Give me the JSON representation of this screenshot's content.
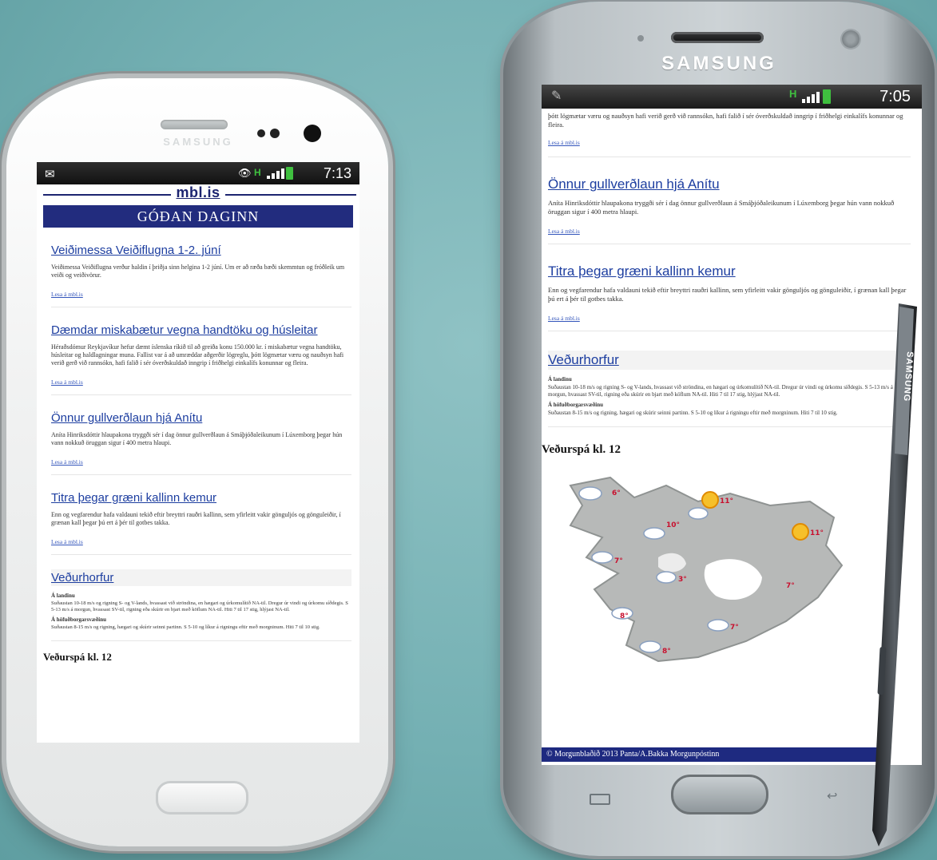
{
  "phone1": {
    "brand": "SAMSUNG",
    "status": {
      "time": "7:13",
      "network": "H"
    },
    "site_logo": "mbl.is",
    "banner": "GÓÐAN DAGINN",
    "articles": [
      {
        "title": "Veiðimessa Veiðiflugna 1-2. júní",
        "body": "Veiðimessa Veiðiflugna verður haldin í þriðja sinn helgina 1-2 júní. Um er að ræða bæði skemmtun og fróðleik um veiði og veiðivörur.",
        "link": "Lesa á mbl.is"
      },
      {
        "title": "Dæmdar miskabætur vegna handtöku og húsleitar",
        "body": "Héraðsdómur Reykjavíkur hefur dæmt íslenska ríkið til að greiða konu 150.000 kr. í miskabætur vegna handtöku, húsleitar og haldlagningar muna. Fallist var á að umræddar aðgerðir lögreglu, þótt lögmætar væru og nauðsyn hafi verið gerð við rannsókn, hafi falið í sér óverðskuldað inngrip í friðhelgi einkalífs konunnar og fleira.",
        "link": "Lesa á mbl.is"
      },
      {
        "title": "Önnur gullverðlaun hjá Anítu",
        "body": "Aníta Hinriksdóttir hlaupakona tryggði sér í dag önnur gullverðlaun á Smáþjóðaleikunum í Lúxemborg þegar hún vann nokkuð öruggan sigur í 400 metra hlaupi.",
        "link": "Lesa á mbl.is"
      },
      {
        "title": "Titra þegar græni kallinn kemur",
        "body": "Enn og vegfarendur hafa valdauni tekið eftir breyttri rauðri kallinn, sem yfirleitt vakir gönguljós og gönguleiðir, í grænan kall þegar þú ert á þér til gotbes takka.",
        "link": "Lesa á mbl.is"
      }
    ],
    "weather": {
      "title": "Veðurhorfur",
      "sub1": "Á landinu",
      "text1": "Suðaustan 10-18 m/s og rigning S- og V-lands, hvassast við ströndina, en hægari og úrkomulítið NA-til. Dregur úr vindi og úrkomu síðdegis. S 5-13 m/s á morgun, hvassast SV-til, rigning eða skúrir en bjart með köflum NA-til. Hiti 7 til 17 stig, hlýjast NA-til.",
      "sub2": "Á höfuðborgarsvæðinu",
      "text2": "Suðaustan 8-15 m/s og rigning, hægari og skúrir seinni partinn. S 5-10 og líkur á rigningu eftir með morgninum. Hiti 7 til 10 stig."
    },
    "forecast_title": "Veðurspá kl. 12"
  },
  "phone2": {
    "brand": "SAMSUNG",
    "status": {
      "time": "7:05",
      "network": "H"
    },
    "continuation": "þótt lögmætar væru og nauðsyn hafi verið gerð við rannsókn, hafi falið í sér óverðskuldað inngrip í friðhelgi einkalífs konunnar og fleira.",
    "continuation_link": "Lesa á mbl.is",
    "articles": [
      {
        "title": "Önnur gullverðlaun hjá Anítu",
        "body": "Aníta Hinriksdóttir hlaupakona tryggði sér í dag önnur gullverðlaun á Smáþjóðaleikunum í Lúxemborg þegar hún vann nokkuð öruggan sigur í 400 metra hlaupi.",
        "link": "Lesa á mbl.is"
      },
      {
        "title": "Titra þegar græni kallinn kemur",
        "body": "Enn og vegfarendur hafa valdauni tekið eftir breyttri rauðri kallinn, sem yfirleitt vakir gönguljós og gönguleiðir, í grænan kall þegar þú ert á þér til gotbes takka.",
        "link": "Lesa á mbl.is"
      }
    ],
    "weather": {
      "title": "Veðurhorfur",
      "sub1": "Á landinu",
      "text1": "Suðaustan 10-18 m/s og rigning S- og V-lands, hvassast við ströndina, en hægari og úrkomulítið NA-til. Dregur úr vindi og úrkomu síðdegis. S 5-13 m/s á morgun, hvassast SV-til, rigning eða skúrir en bjart með köflum NA-til. Hiti 7 til 17 stig, hlýjast NA-til.",
      "sub2": "Á höfuðborgarsvæðinu",
      "text2": "Suðaustan 8-15 m/s og rigning, hægari og skúrir seinni partinn. S 5-10 og líkur á rigningu eftir með morgninum. Hiti 7 til 10 stig."
    },
    "forecast_title": "Veðurspá kl. 12",
    "map_temps": {
      "westfjords": "6°",
      "north": "11°",
      "northeast": "11°",
      "central_north": "10°",
      "west": "7°",
      "highland": "3°",
      "east": "7°",
      "southwest": "8°",
      "southeast": "7°",
      "south": "8°"
    },
    "copyright": "© Morgunblaðið 2013 Panta/A.Bakka Morgunpóstinn"
  },
  "pen": {
    "brand": "SAMSUNG"
  },
  "colors": {
    "background": "#74b0b3",
    "mbl_blue": "#222c7e",
    "link": "#1d3ea0"
  }
}
